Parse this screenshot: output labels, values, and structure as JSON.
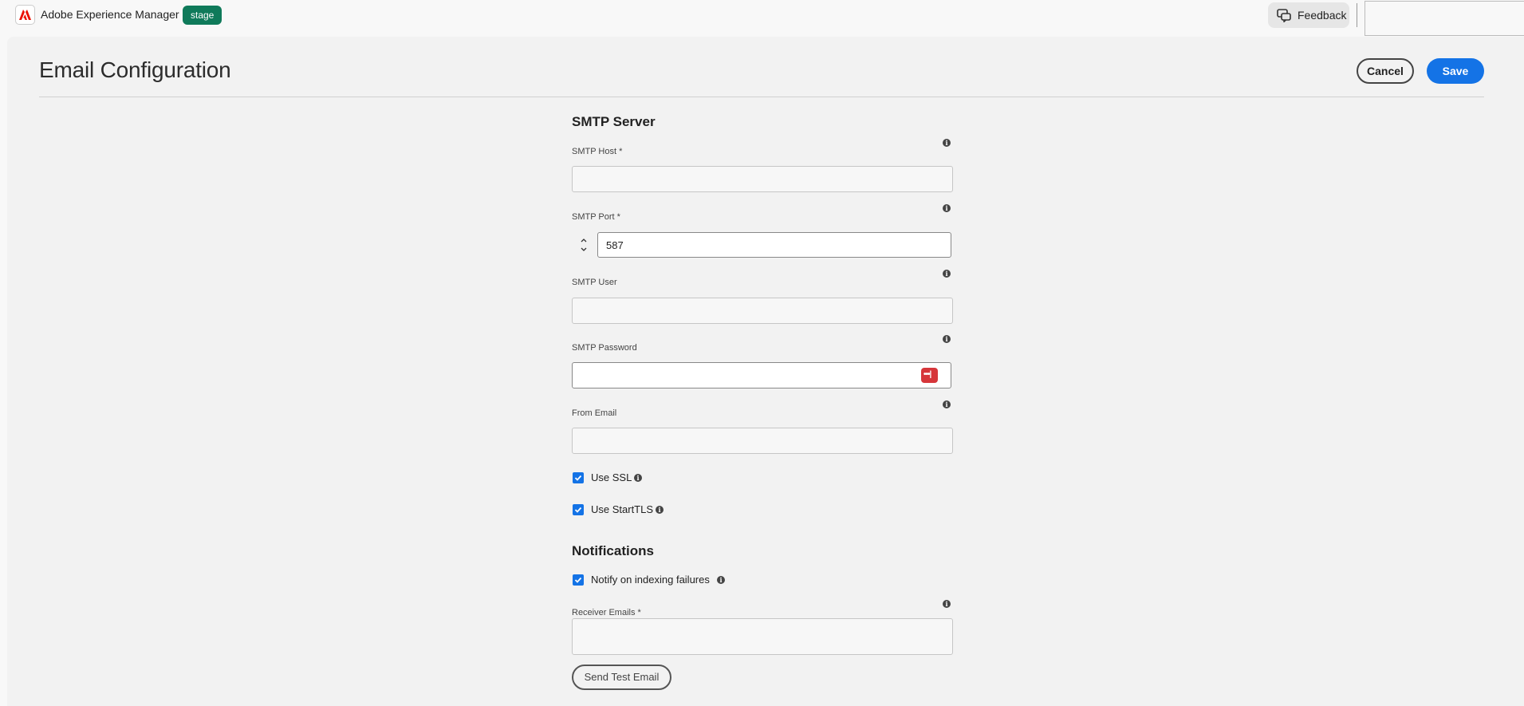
{
  "topbar": {
    "app_title": "Adobe Experience Manager",
    "environment": "stage",
    "feedback_label": "Feedback",
    "env_color": "#0f7a5a"
  },
  "page": {
    "title": "Email Configuration",
    "cancel_label": "Cancel",
    "save_label": "Save",
    "accent_color": "#1473e6"
  },
  "smtp": {
    "heading": "SMTP Server",
    "host_label": "SMTP Host *",
    "host_value": "",
    "port_label": "SMTP Port *",
    "port_value": "587",
    "user_label": "SMTP User",
    "user_value": "",
    "password_label": "SMTP Password",
    "password_value": "",
    "from_label": "From Email",
    "from_value": "",
    "use_ssl_label": "Use SSL",
    "use_ssl_checked": true,
    "use_starttls_label": "Use StartTLS",
    "use_starttls_checked": true
  },
  "notifications": {
    "heading": "Notifications",
    "notify_label": "Notify on indexing failures",
    "notify_checked": true,
    "receivers_label": "Receiver Emails *",
    "receivers_value": "",
    "send_test_label": "Send Test Email"
  },
  "icons": {
    "info": "info-icon",
    "password_manager": "password-manager-icon"
  }
}
